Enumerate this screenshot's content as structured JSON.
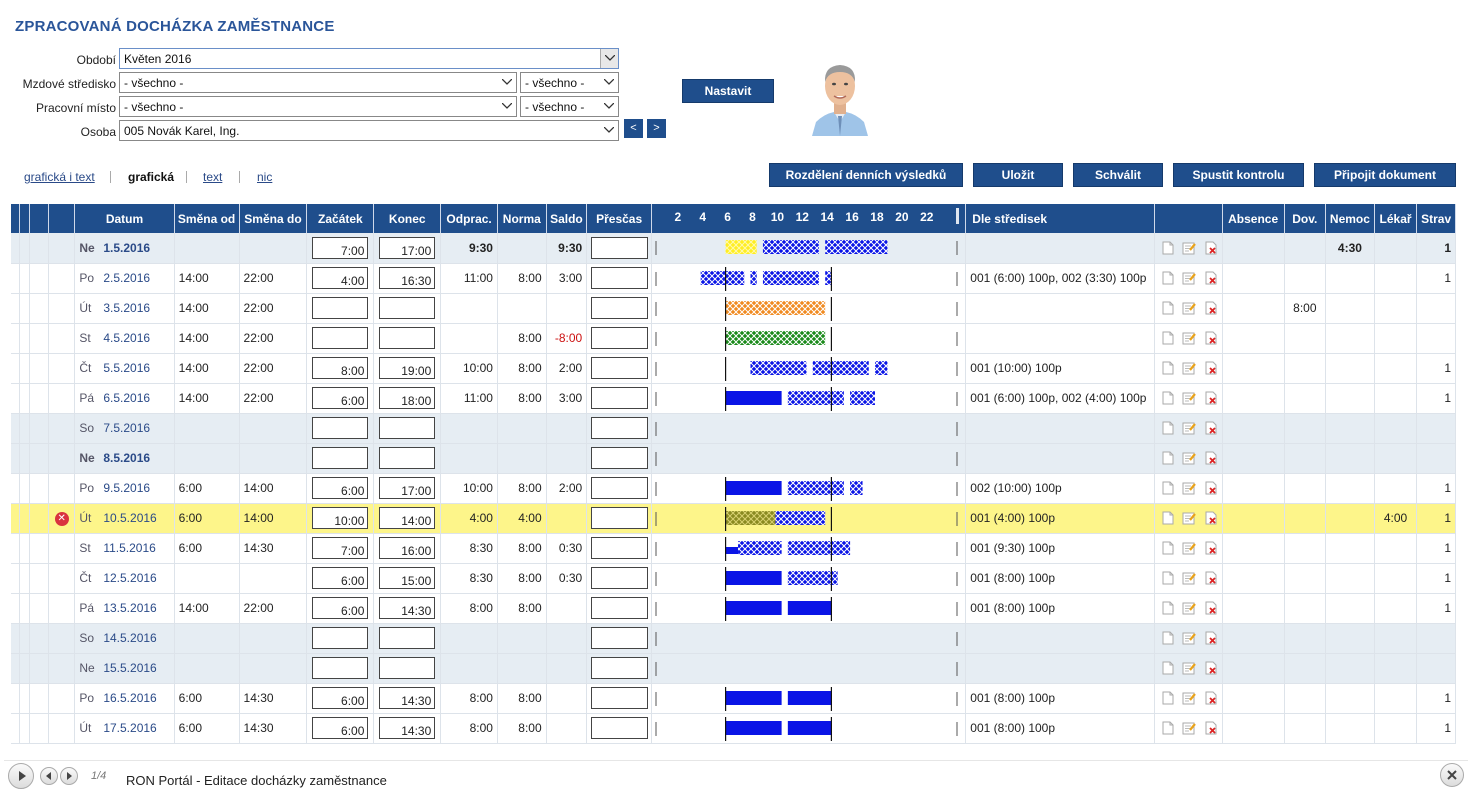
{
  "page": {
    "title": "ZPRACOVANÁ DOCHÁZKA ZAMĚSTNANCE"
  },
  "filters": {
    "obdobi": {
      "label": "Období",
      "value": "Květen 2016"
    },
    "stredisko": {
      "label": "Mzdové středisko",
      "value": "- všechno -",
      "value2": "- všechno -"
    },
    "misto": {
      "label": "Pracovní místo",
      "value": "- všechno -",
      "value2": "- všechno -"
    },
    "osoba": {
      "label": "Osoba",
      "value": "005 Novák Karel, Ing.",
      "prev": "<",
      "next": ">"
    },
    "nastavit": "Nastavit"
  },
  "view_modes": [
    "grafická i text",
    "grafická",
    "text",
    "nic"
  ],
  "actions": {
    "rozdeleni": "Rozdělení denních výsledků",
    "ulozit": "Uložit",
    "schvalit": "Schválit",
    "spustit": "Spustit kontrolu",
    "pripojit": "Připojit dokument"
  },
  "columns": {
    "datum": "Datum",
    "smena_od": "Směna od",
    "smena_do": "Směna do",
    "zacatek": "Začátek",
    "konec": "Konec",
    "odprac": "Odprac.",
    "norma": "Norma",
    "saldo": "Saldo",
    "prescas": "Přesčas",
    "scale": [
      "2",
      "4",
      "6",
      "8",
      "10",
      "12",
      "14",
      "16",
      "18",
      "20",
      "22"
    ],
    "dle_stredisek": "Dle středisek",
    "absence": "Absence",
    "dov": "Dov.",
    "nemoc": "Nemoc",
    "lekar": "Lékař",
    "strav": "Strav"
  },
  "rows": [
    {
      "day": "Ne",
      "date": "1.5.2016",
      "smena_od": "",
      "smena_do": "",
      "zacatek": "7:00",
      "konec": "17:00",
      "odprac": "9:30",
      "norma": "",
      "saldo": "9:30",
      "stred": "",
      "absence": "",
      "dov": "",
      "nemoc": "4:30",
      "lekar": "",
      "strav": "1",
      "type": "we",
      "bold": true,
      "error": false,
      "bars": [
        {
          "from": 6,
          "to": 8.5,
          "fill": "yellow"
        },
        {
          "from": 9,
          "to": 13.5,
          "fill": "bluehatch"
        },
        {
          "from": 14,
          "to": 19,
          "fill": "bluehatch"
        }
      ],
      "marks": []
    },
    {
      "day": "Po",
      "date": "2.5.2016",
      "smena_od": "14:00",
      "smena_do": "22:00",
      "zacatek": "4:00",
      "konec": "16:30",
      "odprac": "11:00",
      "norma": "8:00",
      "saldo": "3:00",
      "stred": "001 (6:00) 100p, 002 (3:30) 100p",
      "absence": "",
      "dov": "",
      "nemoc": "",
      "lekar": "",
      "strav": "1",
      "type": "wd",
      "bold": false,
      "error": false,
      "bars": [
        {
          "from": 4,
          "to": 7.5,
          "fill": "bluehatch"
        },
        {
          "from": 8,
          "to": 8.5,
          "fill": "bluehatch"
        },
        {
          "from": 9,
          "to": 13.5,
          "fill": "bluehatch"
        },
        {
          "from": 14,
          "to": 14.5,
          "fill": "bluehatch"
        }
      ],
      "marks": [
        6,
        14.5
      ]
    },
    {
      "day": "Út",
      "date": "3.5.2016",
      "smena_od": "14:00",
      "smena_do": "22:00",
      "zacatek": "",
      "konec": "",
      "odprac": "",
      "norma": "",
      "saldo": "",
      "stred": "",
      "absence": "",
      "dov": "8:00",
      "nemoc": "",
      "lekar": "",
      "strav": "",
      "type": "wd",
      "bold": false,
      "error": false,
      "bars": [
        {
          "from": 6,
          "to": 14,
          "fill": "orangehatch"
        }
      ],
      "marks": [
        6,
        14.5
      ]
    },
    {
      "day": "St",
      "date": "4.5.2016",
      "smena_od": "14:00",
      "smena_do": "22:00",
      "zacatek": "",
      "konec": "",
      "odprac": "",
      "norma": "8:00",
      "saldo": "-8:00",
      "stred": "",
      "absence": "",
      "dov": "",
      "nemoc": "",
      "lekar": "",
      "strav": "",
      "type": "wd",
      "bold": false,
      "error": false,
      "saldo_red": true,
      "bars": [
        {
          "from": 6,
          "to": 14,
          "fill": "greenhatch"
        }
      ],
      "marks": [
        6,
        14.5
      ]
    },
    {
      "day": "Čt",
      "date": "5.5.2016",
      "smena_od": "14:00",
      "smena_do": "22:00",
      "zacatek": "8:00",
      "konec": "19:00",
      "odprac": "10:00",
      "norma": "8:00",
      "saldo": "2:00",
      "stred": "001 (10:00) 100p",
      "absence": "",
      "dov": "",
      "nemoc": "",
      "lekar": "",
      "strav": "1",
      "type": "wd",
      "bold": false,
      "error": false,
      "bars": [
        {
          "from": 8,
          "to": 12.5,
          "fill": "bluehatch"
        },
        {
          "from": 13,
          "to": 17.5,
          "fill": "bluehatch"
        },
        {
          "from": 18,
          "to": 19,
          "fill": "bluehatch"
        }
      ],
      "marks": [
        6,
        14.5
      ]
    },
    {
      "day": "Pá",
      "date": "6.5.2016",
      "smena_od": "14:00",
      "smena_do": "22:00",
      "zacatek": "6:00",
      "konec": "18:00",
      "odprac": "11:00",
      "norma": "8:00",
      "saldo": "3:00",
      "stred": "001 (6:00) 100p, 002 (4:00) 100p",
      "absence": "",
      "dov": "",
      "nemoc": "",
      "lekar": "",
      "strav": "1",
      "type": "wd",
      "bold": false,
      "error": false,
      "bars": [
        {
          "from": 6,
          "to": 10.5,
          "fill": "blue"
        },
        {
          "from": 11,
          "to": 15.5,
          "fill": "bluehatch"
        },
        {
          "from": 16,
          "to": 18,
          "fill": "bluehatch"
        }
      ],
      "marks": [
        6,
        14.5
      ]
    },
    {
      "day": "So",
      "date": "7.5.2016",
      "smena_od": "",
      "smena_do": "",
      "zacatek": "",
      "konec": "",
      "odprac": "",
      "norma": "",
      "saldo": "",
      "stred": "",
      "absence": "",
      "dov": "",
      "nemoc": "",
      "lekar": "",
      "strav": "",
      "type": "we",
      "bold": false,
      "error": false,
      "bars": [],
      "marks": []
    },
    {
      "day": "Ne",
      "date": "8.5.2016",
      "smena_od": "",
      "smena_do": "",
      "zacatek": "",
      "konec": "",
      "odprac": "",
      "norma": "",
      "saldo": "",
      "stred": "",
      "absence": "",
      "dov": "",
      "nemoc": "",
      "lekar": "",
      "strav": "",
      "type": "we",
      "bold": true,
      "error": false,
      "bars": [],
      "marks": []
    },
    {
      "day": "Po",
      "date": "9.5.2016",
      "smena_od": "6:00",
      "smena_do": "14:00",
      "zacatek": "6:00",
      "konec": "17:00",
      "odprac": "10:00",
      "norma": "8:00",
      "saldo": "2:00",
      "stred": "002 (10:00) 100p",
      "absence": "",
      "dov": "",
      "nemoc": "",
      "lekar": "",
      "strav": "1",
      "type": "wd",
      "bold": false,
      "error": false,
      "bars": [
        {
          "from": 6,
          "to": 10.5,
          "fill": "blue"
        },
        {
          "from": 11,
          "to": 15.5,
          "fill": "bluehatch"
        },
        {
          "from": 16,
          "to": 17,
          "fill": "bluehatch"
        }
      ],
      "marks": [
        6,
        14.5
      ]
    },
    {
      "day": "Út",
      "date": "10.5.2016",
      "smena_od": "6:00",
      "smena_do": "14:00",
      "zacatek": "10:00",
      "konec": "14:00",
      "odprac": "4:00",
      "norma": "4:00",
      "saldo": "",
      "stred": "001 (4:00) 100p",
      "absence": "",
      "dov": "",
      "nemoc": "",
      "lekar": "4:00",
      "strav": "1",
      "type": "hl",
      "bold": false,
      "error": true,
      "bars": [
        {
          "from": 6,
          "to": 10,
          "fill": "olivehatch"
        },
        {
          "from": 10,
          "to": 14,
          "fill": "bluehatch"
        }
      ],
      "marks": [
        6,
        14.5
      ]
    },
    {
      "day": "St",
      "date": "11.5.2016",
      "smena_od": "6:00",
      "smena_do": "14:30",
      "zacatek": "7:00",
      "konec": "16:00",
      "odprac": "8:30",
      "norma": "8:00",
      "saldo": "0:30",
      "stred": "001 (9:30) 100p",
      "absence": "",
      "dov": "",
      "nemoc": "",
      "lekar": "",
      "strav": "1",
      "type": "wd",
      "bold": false,
      "error": false,
      "bars": [
        {
          "from": 6,
          "to": 7,
          "fill": "blue",
          "partial": true
        },
        {
          "from": 7,
          "to": 10.5,
          "fill": "bluehatch"
        },
        {
          "from": 11,
          "to": 16,
          "fill": "bluehatch"
        }
      ],
      "marks": [
        6,
        14.5
      ]
    },
    {
      "day": "Čt",
      "date": "12.5.2016",
      "smena_od": "",
      "smena_do": "",
      "zacatek": "6:00",
      "konec": "15:00",
      "odprac": "8:30",
      "norma": "8:00",
      "saldo": "0:30",
      "stred": "001 (8:00) 100p",
      "absence": "",
      "dov": "",
      "nemoc": "",
      "lekar": "",
      "strav": "1",
      "type": "wd",
      "bold": false,
      "error": false,
      "bars": [
        {
          "from": 6,
          "to": 10.5,
          "fill": "blue"
        },
        {
          "from": 11,
          "to": 15,
          "fill": "bluehatch"
        }
      ],
      "marks": [
        6,
        14.5
      ]
    },
    {
      "day": "Pá",
      "date": "13.5.2016",
      "smena_od": "14:00",
      "smena_do": "22:00",
      "zacatek": "6:00",
      "konec": "14:30",
      "odprac": "8:00",
      "norma": "8:00",
      "saldo": "",
      "stred": "001 (8:00) 100p",
      "absence": "",
      "dov": "",
      "nemoc": "",
      "lekar": "",
      "strav": "1",
      "type": "wd",
      "bold": false,
      "error": false,
      "bars": [
        {
          "from": 6,
          "to": 10.5,
          "fill": "blue"
        },
        {
          "from": 11,
          "to": 14.5,
          "fill": "blue"
        }
      ],
      "marks": [
        6,
        14.5
      ]
    },
    {
      "day": "So",
      "date": "14.5.2016",
      "smena_od": "",
      "smena_do": "",
      "zacatek": "",
      "konec": "",
      "odprac": "",
      "norma": "",
      "saldo": "",
      "stred": "",
      "absence": "",
      "dov": "",
      "nemoc": "",
      "lekar": "",
      "strav": "",
      "type": "we",
      "bold": false,
      "error": false,
      "bars": [],
      "marks": []
    },
    {
      "day": "Ne",
      "date": "15.5.2016",
      "smena_od": "",
      "smena_do": "",
      "zacatek": "",
      "konec": "",
      "odprac": "",
      "norma": "",
      "saldo": "",
      "stred": "",
      "absence": "",
      "dov": "",
      "nemoc": "",
      "lekar": "",
      "strav": "",
      "type": "we",
      "bold": false,
      "error": false,
      "bars": [],
      "marks": []
    },
    {
      "day": "Po",
      "date": "16.5.2016",
      "smena_od": "6:00",
      "smena_do": "14:30",
      "zacatek": "6:00",
      "konec": "14:30",
      "odprac": "8:00",
      "norma": "8:00",
      "saldo": "",
      "stred": "001 (8:00) 100p",
      "absence": "",
      "dov": "",
      "nemoc": "",
      "lekar": "",
      "strav": "1",
      "type": "wd",
      "bold": false,
      "error": false,
      "bars": [
        {
          "from": 6,
          "to": 10.5,
          "fill": "blue"
        },
        {
          "from": 11,
          "to": 14.5,
          "fill": "blue"
        }
      ],
      "marks": [
        6,
        14.5
      ]
    },
    {
      "day": "Út",
      "date": "17.5.2016",
      "smena_od": "6:00",
      "smena_do": "14:30",
      "zacatek": "6:00",
      "konec": "14:30",
      "odprac": "8:00",
      "norma": "8:00",
      "saldo": "",
      "stred": "001 (8:00) 100p",
      "absence": "",
      "dov": "",
      "nemoc": "",
      "lekar": "",
      "strav": "1",
      "type": "wd",
      "bold": false,
      "error": false,
      "bars": [
        {
          "from": 6,
          "to": 10.5,
          "fill": "blue"
        },
        {
          "from": 11,
          "to": 14.5,
          "fill": "blue"
        }
      ],
      "marks": [
        6,
        14.5
      ]
    }
  ],
  "footer": {
    "page": "1/4",
    "title": "RON Portál - Editace docházky zaměstnance"
  },
  "colors": {
    "header_blue": "#1f4e8c",
    "title_blue": "#2a5599",
    "bar_blue": "#0a14e6",
    "bar_yellow": "#ffee22",
    "bar_orange": "#f08a20",
    "bar_green": "#1a8a1a",
    "bar_olive": "#8a8a20",
    "highlight_row": "#fdf58a",
    "weekend_row": "#e6edf3",
    "negative": "#cc1111"
  }
}
